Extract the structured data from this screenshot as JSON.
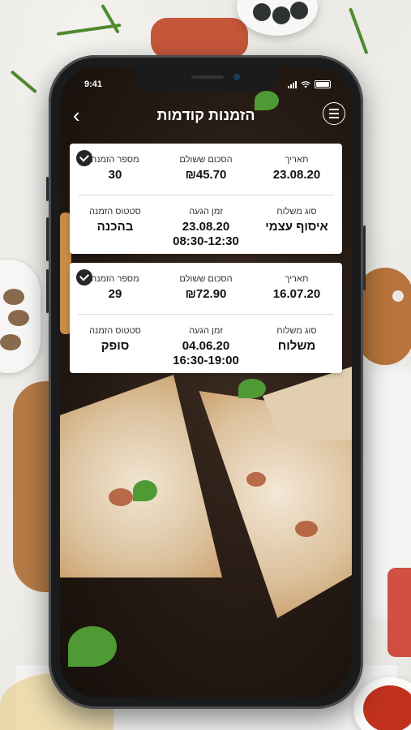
{
  "status_bar": {
    "time": "9:41"
  },
  "header": {
    "title": "הזמנות קודמות",
    "back_icon": "chevron-left-icon",
    "menu_icon": "hamburger-menu-icon"
  },
  "orders": [
    {
      "date_label": "תאריך",
      "date": "23.08.20",
      "amount_label": "הסכום ששולם",
      "amount": "₪45.70",
      "number_label": "מספר הזמנה",
      "number": "30",
      "delivery_type_label": "סוג משלוח",
      "delivery_type": "איסוף עצמי",
      "arrival_label": "זמן הגעה",
      "arrival_date": "23.08.20",
      "arrival_window": "08:30-12:30",
      "status_label": "סטטוס הזמנה",
      "status": "בהכנה"
    },
    {
      "date_label": "תאריך",
      "date": "16.07.20",
      "amount_label": "הסכום ששולם",
      "amount": "₪72.90",
      "number_label": "מספר הזמנה",
      "number": "29",
      "delivery_type_label": "סוג משלוח",
      "delivery_type": "משלוח",
      "arrival_label": "זמן הגעה",
      "arrival_date": "04.06.20",
      "arrival_window": "16:30-19:00",
      "status_label": "סטטוס הזמנה",
      "status": "סופק"
    }
  ]
}
